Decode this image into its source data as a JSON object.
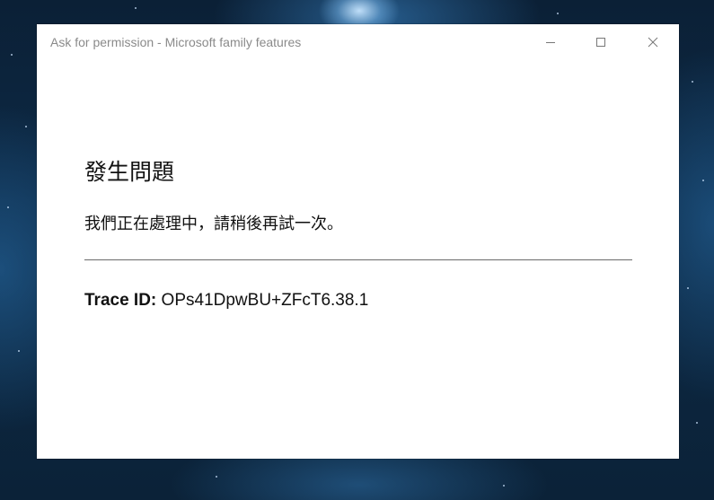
{
  "window": {
    "title": "Ask for permission - Microsoft family features",
    "controls": {
      "minimize_icon": "minimize-icon",
      "maximize_icon": "maximize-icon",
      "close_icon": "close-icon"
    }
  },
  "error": {
    "heading": "發生問題",
    "message": "我們正在處理中，請稍後再試一次。",
    "trace_label": "Trace ID:",
    "trace_value": "OPs41DpwBU+ZFcT6.38.1"
  },
  "colors": {
    "window_bg": "#ffffff",
    "title_text": "#8a8a8a",
    "body_text": "#111111",
    "divider": "#6b6b6b"
  }
}
